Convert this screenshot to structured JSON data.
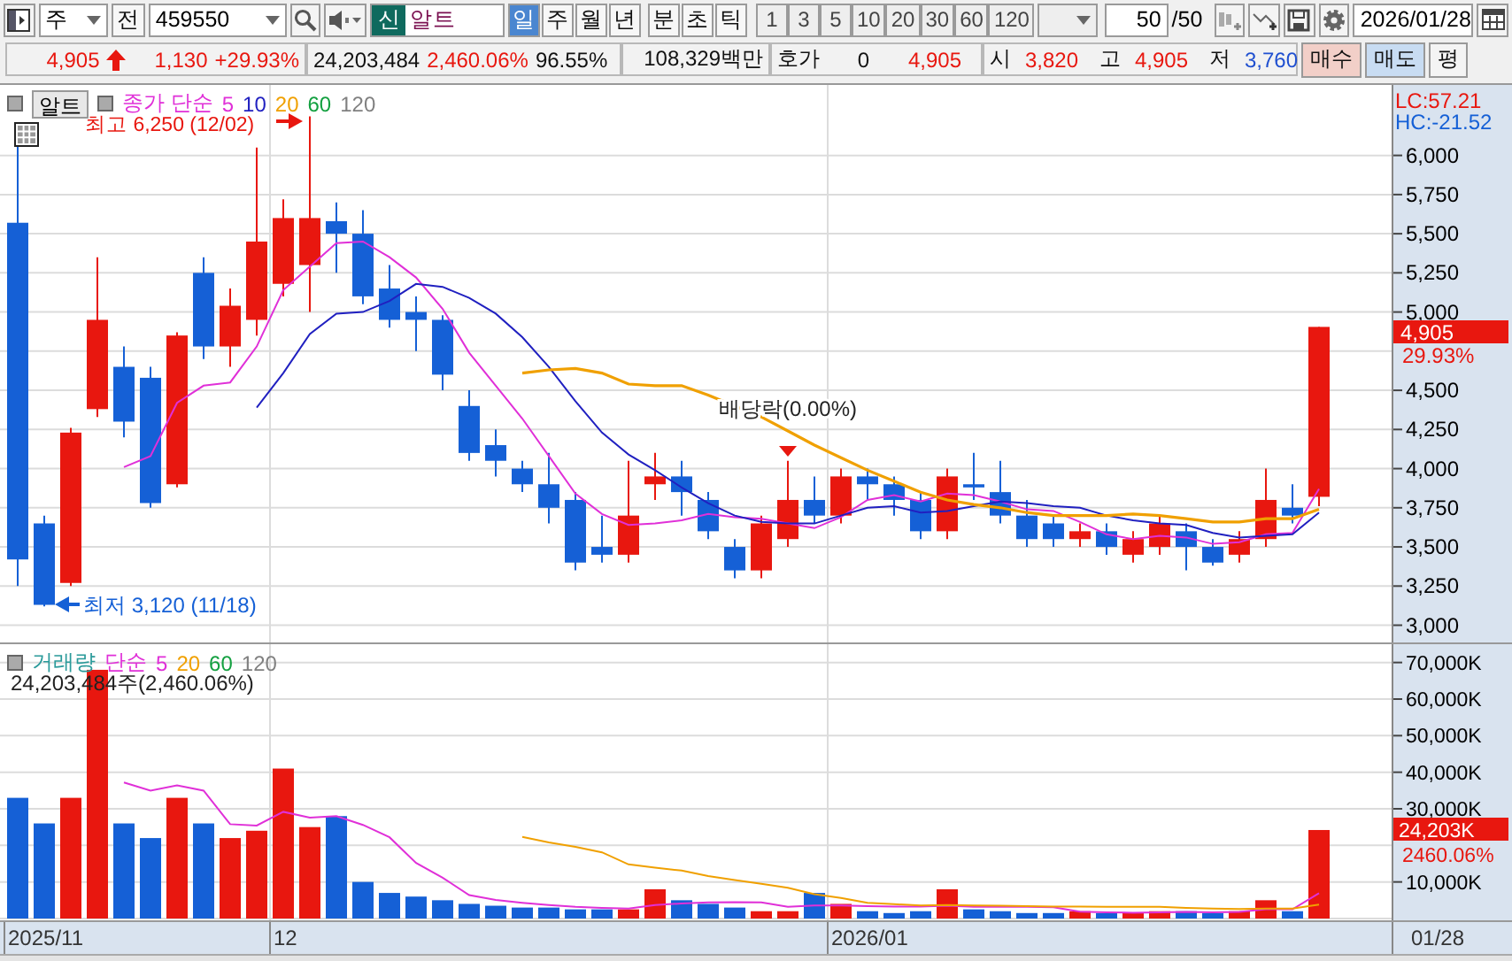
{
  "toolbar": {
    "chart_type": "주",
    "prev_label": "전",
    "code": "459550",
    "badge": "신",
    "name": "알트",
    "periods": [
      {
        "label": "일",
        "selected": true
      },
      {
        "label": "주",
        "selected": false
      },
      {
        "label": "월",
        "selected": false
      },
      {
        "label": "년",
        "selected": false
      },
      {
        "label": "분",
        "selected": false
      },
      {
        "label": "초",
        "selected": false
      },
      {
        "label": "틱",
        "selected": false
      }
    ],
    "intervals": [
      "1",
      "3",
      "5",
      "10",
      "20",
      "30",
      "60",
      "120"
    ],
    "count": "50",
    "count_total": "/50",
    "date": "2026/01/28"
  },
  "quote": {
    "price": "4,905",
    "change": "1,130",
    "change_rate": "+29.93%",
    "volume": "24,203,484",
    "volume_rate": "2,460.06%",
    "turnover_rate": "96.55%",
    "amount": "108,329백만",
    "ask_label": "호가",
    "ask_value": "0",
    "ask_price": "4,905",
    "open_label": "시",
    "open": "3,820",
    "high_label": "고",
    "high": "4,905",
    "low_label": "저",
    "low": "3,760",
    "buttons": [
      {
        "label": "매수",
        "kind": "buy"
      },
      {
        "label": "매도",
        "kind": "sell"
      },
      {
        "label": "평",
        "kind": "plain"
      }
    ]
  },
  "price_chart": {
    "tab": "알트",
    "legend_title": "종가 단순",
    "legend_extra": [
      {
        "label": "60",
        "color": "#13a040"
      },
      {
        "label": "120",
        "color": "#808080"
      }
    ],
    "high_note": "최고 6,250 (12/02)",
    "low_note": "최저 3,120 (11/18)",
    "event_note": "배당락(0.00%)",
    "lc": "LC:57.21",
    "hc": "HC:-21.52",
    "last_price": "4,905",
    "last_change": "29.93%",
    "chart_data": {
      "type": "candlestick",
      "grid": true,
      "ylim": [
        2890,
        6450
      ],
      "yticks": [
        {
          "value": 6000,
          "label": "6,000"
        },
        {
          "value": 5750,
          "label": "5,750"
        },
        {
          "value": 5500,
          "label": "5,500"
        },
        {
          "value": 5250,
          "label": "5,250"
        },
        {
          "value": 5000,
          "label": "5,000"
        },
        {
          "value": 4500,
          "label": "4,500"
        },
        {
          "value": 4250,
          "label": "4,250"
        },
        {
          "value": 4000,
          "label": "4,000"
        },
        {
          "value": 3750,
          "label": "3,750"
        },
        {
          "value": 3500,
          "label": "3,500"
        },
        {
          "value": 3250,
          "label": "3,250"
        },
        {
          "value": 3000,
          "label": "3,000"
        }
      ],
      "series": [
        {
          "name": "5",
          "type": "line",
          "color": "#e030d8",
          "values": [
            null,
            null,
            null,
            null,
            4010,
            4080,
            4420,
            4530,
            4550,
            4780,
            5140,
            5290,
            5440,
            5450,
            5350,
            5220,
            5020,
            4740,
            4530,
            4320,
            4080,
            3840,
            3710,
            3640,
            3650,
            3670,
            3710,
            3690,
            3680,
            3650,
            3620,
            3690,
            3800,
            3830,
            3790,
            3840,
            3830,
            3790,
            3740,
            3730,
            3660,
            3580,
            3550,
            3570,
            3560,
            3520,
            3530,
            3580,
            3590,
            3870
          ]
        },
        {
          "name": "10",
          "type": "line",
          "color": "#2020c0",
          "values": [
            null,
            null,
            null,
            null,
            null,
            null,
            null,
            null,
            null,
            4390,
            4610,
            4860,
            4990,
            5000,
            5070,
            5180,
            5160,
            5090,
            4990,
            4840,
            4650,
            4430,
            4230,
            4090,
            3990,
            3880,
            3780,
            3700,
            3660,
            3650,
            3650,
            3700,
            3750,
            3760,
            3720,
            3730,
            3760,
            3790,
            3780,
            3760,
            3750,
            3700,
            3670,
            3650,
            3640,
            3590,
            3560,
            3570,
            3580,
            3720
          ]
        },
        {
          "name": "20",
          "type": "line",
          "color": "#f0a000",
          "values": [
            null,
            null,
            null,
            null,
            null,
            null,
            null,
            null,
            null,
            null,
            null,
            null,
            null,
            null,
            null,
            null,
            null,
            null,
            null,
            4610,
            4630,
            4640,
            4610,
            4540,
            4530,
            4530,
            4470,
            4400,
            4330,
            4240,
            4150,
            4070,
            3990,
            3920,
            3850,
            3800,
            3770,
            3750,
            3720,
            3700,
            3700,
            3700,
            3710,
            3700,
            3680,
            3660,
            3660,
            3680,
            3680,
            3740
          ]
        }
      ],
      "ohlc": [
        [
          5570,
          6080,
          3250,
          3420
        ],
        [
          3650,
          3700,
          3120,
          3130
        ],
        [
          3270,
          4260,
          3250,
          4230
        ],
        [
          4380,
          5350,
          4330,
          4950
        ],
        [
          4650,
          4780,
          4200,
          4300
        ],
        [
          4580,
          4650,
          3750,
          3780
        ],
        [
          3900,
          4870,
          3880,
          4850
        ],
        [
          5250,
          5350,
          4700,
          4780
        ],
        [
          4780,
          5150,
          4650,
          5040
        ],
        [
          4950,
          6050,
          4850,
          5450
        ],
        [
          5180,
          5720,
          5100,
          5600
        ],
        [
          5300,
          6250,
          5000,
          5600
        ],
        [
          5580,
          5700,
          5250,
          5500
        ],
        [
          5500,
          5650,
          5050,
          5100
        ],
        [
          5150,
          5300,
          4900,
          4950
        ],
        [
          5000,
          5100,
          4750,
          4950
        ],
        [
          4950,
          4980,
          4500,
          4600
        ],
        [
          4400,
          4500,
          4050,
          4100
        ],
        [
          4150,
          4250,
          3950,
          4050
        ],
        [
          4000,
          4050,
          3850,
          3900
        ],
        [
          3900,
          4100,
          3650,
          3750
        ],
        [
          3800,
          3850,
          3350,
          3400
        ],
        [
          3500,
          3700,
          3400,
          3450
        ],
        [
          3450,
          4050,
          3400,
          3700
        ],
        [
          3900,
          4100,
          3800,
          3950
        ],
        [
          3950,
          4050,
          3700,
          3850
        ],
        [
          3800,
          3850,
          3550,
          3600
        ],
        [
          3500,
          3550,
          3300,
          3350
        ],
        [
          3350,
          3700,
          3300,
          3650
        ],
        [
          3550,
          4050,
          3500,
          3800
        ],
        [
          3800,
          3950,
          3650,
          3700
        ],
        [
          3700,
          4000,
          3650,
          3950
        ],
        [
          3950,
          4000,
          3800,
          3900
        ],
        [
          3900,
          3950,
          3700,
          3800
        ],
        [
          3800,
          3850,
          3550,
          3600
        ],
        [
          3600,
          4000,
          3550,
          3950
        ],
        [
          3900,
          4100,
          3800,
          3880
        ],
        [
          3850,
          4050,
          3650,
          3700
        ],
        [
          3700,
          3800,
          3500,
          3550
        ],
        [
          3650,
          3700,
          3500,
          3550
        ],
        [
          3550,
          3650,
          3500,
          3600
        ],
        [
          3600,
          3650,
          3450,
          3500
        ],
        [
          3450,
          3600,
          3400,
          3550
        ],
        [
          3500,
          3700,
          3450,
          3650
        ],
        [
          3600,
          3650,
          3350,
          3500
        ],
        [
          3500,
          3550,
          3380,
          3400
        ],
        [
          3450,
          3600,
          3400,
          3550
        ],
        [
          3550,
          4000,
          3500,
          3800
        ],
        [
          3750,
          3900,
          3650,
          3700
        ],
        [
          3820,
          4905,
          3760,
          4905
        ]
      ]
    }
  },
  "volume_chart": {
    "legend_title": "단순",
    "legend_extra": [
      {
        "label": "60",
        "color": "#13a040"
      },
      {
        "label": "120",
        "color": "#808080"
      }
    ],
    "summary": "24,203,484주(2,460.06%)",
    "last_volume": "24,203K",
    "last_rate": "2460.06%",
    "chart_data": {
      "type": "bar",
      "grid": true,
      "ylim": [
        0,
        75000
      ],
      "yticks": [
        {
          "value": 70000,
          "label": "70,000K"
        },
        {
          "value": 60000,
          "label": "60,000K"
        },
        {
          "value": 50000,
          "label": "50,000K"
        },
        {
          "value": 40000,
          "label": "40,000K"
        },
        {
          "value": 30000,
          "label": "30,000K"
        },
        {
          "value": 10000,
          "label": "10,000K"
        }
      ],
      "series": [
        {
          "name": "거래량",
          "type": "bar",
          "colors": [
            "#1560d6",
            "#1560d6",
            "#e8170f",
            "#e8170f",
            "#1560d6",
            "#1560d6",
            "#e8170f",
            "#1560d6",
            "#e8170f",
            "#e8170f",
            "#e8170f",
            "#e8170f",
            "#1560d6",
            "#1560d6",
            "#1560d6",
            "#1560d6",
            "#1560d6",
            "#1560d6",
            "#1560d6",
            "#1560d6",
            "#1560d6",
            "#1560d6",
            "#1560d6",
            "#e8170f",
            "#e8170f",
            "#1560d6",
            "#1560d6",
            "#1560d6",
            "#e8170f",
            "#e8170f",
            "#1560d6",
            "#e8170f",
            "#1560d6",
            "#1560d6",
            "#1560d6",
            "#e8170f",
            "#1560d6",
            "#1560d6",
            "#1560d6",
            "#1560d6",
            "#e8170f",
            "#1560d6",
            "#e8170f",
            "#e8170f",
            "#1560d6",
            "#1560d6",
            "#e8170f",
            "#e8170f",
            "#1560d6",
            "#e8170f"
          ],
          "values": [
            33000,
            26000,
            33000,
            68000,
            26000,
            22000,
            33000,
            26000,
            22000,
            24000,
            41000,
            25000,
            28000,
            10000,
            7000,
            6000,
            5000,
            4000,
            3500,
            3000,
            3000,
            2500,
            2500,
            2500,
            8000,
            5000,
            4000,
            3000,
            2000,
            2000,
            7000,
            4000,
            2000,
            1500,
            2000,
            8000,
            2500,
            2000,
            1500,
            1500,
            2000,
            1500,
            1500,
            2000,
            2000,
            1500,
            2000,
            5000,
            2000,
            24200
          ]
        },
        {
          "name": "5",
          "type": "line",
          "color": "#e030d8",
          "values": [
            null,
            null,
            null,
            null,
            37200,
            35000,
            36400,
            35000,
            25800,
            25400,
            29200,
            27600,
            28000,
            25600,
            22200,
            15200,
            11200,
            6400,
            5100,
            4300,
            3700,
            3200,
            2900,
            2700,
            3700,
            4100,
            4400,
            4500,
            4400,
            3200,
            3600,
            3600,
            3400,
            3300,
            3300,
            3500,
            3200,
            3200,
            3200,
            3100,
            1900,
            1700,
            1600,
            1700,
            1800,
            1700,
            1800,
            2500,
            2500,
            6900
          ]
        },
        {
          "name": "20",
          "type": "line",
          "color": "#f0a000",
          "values": [
            null,
            null,
            null,
            null,
            null,
            null,
            null,
            null,
            null,
            null,
            null,
            null,
            null,
            null,
            null,
            null,
            null,
            null,
            null,
            22300,
            20800,
            19600,
            18100,
            14800,
            13900,
            13100,
            11600,
            10500,
            9500,
            8400,
            6700,
            5600,
            4300,
            3900,
            3600,
            3700,
            3600,
            3500,
            3400,
            3300,
            3300,
            3200,
            3200,
            3200,
            2900,
            2700,
            2600,
            2700,
            2700,
            3800
          ]
        }
      ]
    }
  },
  "date_axis": {
    "labels": [
      "2025/11",
      "12",
      "2026/01"
    ],
    "current": "01/28"
  }
}
